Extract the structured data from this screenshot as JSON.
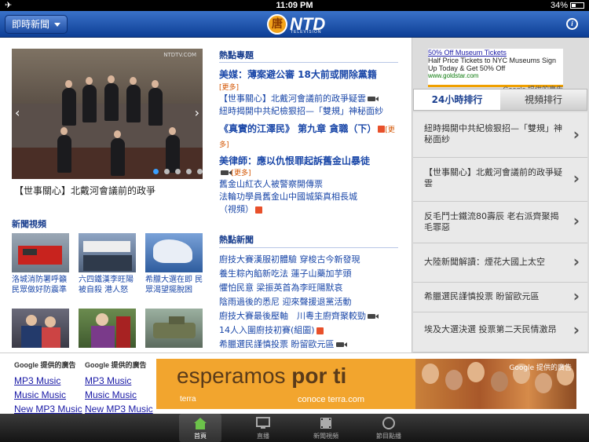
{
  "status_bar": {
    "time": "11:09 PM",
    "battery": "34%"
  },
  "nav": {
    "menu_label": "即時新聞",
    "logo_text": "NTD",
    "logo_sub": "TELEVISION",
    "logo_seal": "新唐人"
  },
  "hero": {
    "caption": "【世事關心】北戴河會議前的政爭",
    "watermark": "NTDTV.COM"
  },
  "video_section": {
    "title": "新聞視頻",
    "items": [
      {
        "caption": "洛城消防署呼籲民眾做好防震準"
      },
      {
        "caption": "六四鐵漢李旺陽被自殺 港人怒"
      },
      {
        "caption": "希臘大選在即 民眾渴望擺脫困"
      },
      {
        "caption": ""
      },
      {
        "caption": ""
      },
      {
        "caption": ""
      }
    ]
  },
  "hot_topics": {
    "title": "熱點專題",
    "more_label": "[更多]",
    "items": [
      {
        "headline": "美媒：薄案避公審 18大前或開除黨籍",
        "links": [
          "【世事關心】北戴河會議前的政爭疑雲",
          "紐時揭開中共紀檢狠招—「雙規」神秘面紗"
        ]
      },
      {
        "headline": "《真實的江澤民》 第九章 貪職（下）",
        "links": []
      },
      {
        "headline": "美律師：應以仇恨罪起訴舊金山暴徒",
        "links": [
          "舊金山紅衣人被警察開傳票",
          "法輪功學員舊金山中國城築真相長城（視頻）"
        ]
      }
    ]
  },
  "hot_news": {
    "title": "熱點新聞",
    "items": [
      "廚技大賽漢服初體驗 穿梭古今新發現",
      "養生粽內餡新吃法 蓮子山藥加芋頭",
      "懼怕民意 梁振英首為李旺陽默哀",
      "陰雨過後的悉尼 迎來聲援退黨活動",
      "廚技大賽最後壓軸　川粵主廚齊聚較勁",
      "14人入圍廚技初賽(組圖)",
      "希臘選民謹慎投票 盼留歐元區"
    ]
  },
  "sidebar_ad": {
    "title": "50% Off Museum Tickets",
    "description": "Half Price Tickets to NYC Museums Sign Up Today & Get 50% Off",
    "url": "www.goldstar.com",
    "attribution": "Google 提供的廣告"
  },
  "ranking": {
    "tabs": [
      "24小時排行",
      "視頻排行"
    ],
    "items": [
      "紐時揭開中共紀檢狠招—「雙規」神秘面紗",
      "【世事關心】北戴河會議前的政爭疑雲",
      "反毛鬥士鐵流80壽辰 老右派齊聚揭毛罪惡",
      "大陸新聞解讀：煙花大國上太空",
      "希臘選民謹慎投票 盼留歐元區",
      "埃及大選決選 投票第二天民情激昂"
    ]
  },
  "bottom_ads": {
    "header": "Google 提供的廣告",
    "links": [
      "MP3 Music",
      "Music Music",
      "New MP3 Music"
    ],
    "banner": {
      "text_a": "esperamos ",
      "text_b": "por ti",
      "brand": "terra",
      "cta": "conoce terra.com",
      "attribution": "Google 提供的廣告"
    }
  },
  "tabbar": [
    "首頁",
    "直播",
    "新聞視頻",
    "節目點播"
  ],
  "colors": {
    "nav_blue": "#1a4aa0",
    "link_blue": "#1a47a8",
    "accent_orange": "#d35400"
  }
}
